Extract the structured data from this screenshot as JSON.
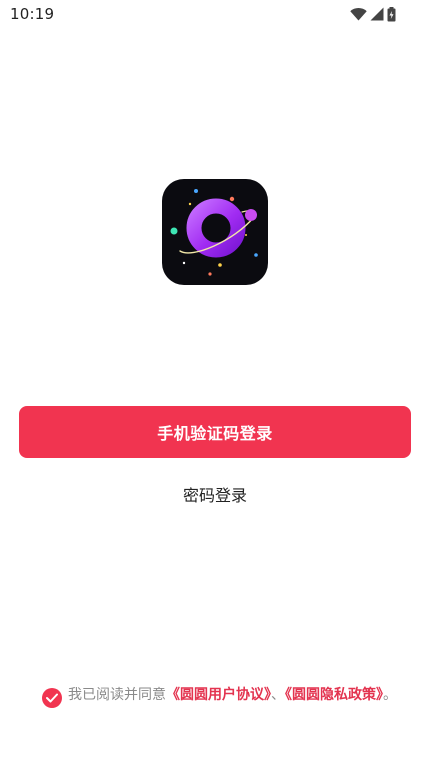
{
  "status_bar": {
    "time": "10:19",
    "icons": [
      "wifi-icon",
      "signal-icon",
      "battery-icon"
    ]
  },
  "logo": {
    "icon": "planet-ring-logo-icon"
  },
  "login": {
    "primary_label": "手机验证码登录",
    "secondary_label": "密码登录"
  },
  "agreement": {
    "checked": true,
    "prefix": "我已阅读并同意",
    "user_agreement": "《圆圆用户协议》",
    "separator": "、",
    "privacy_policy": "《圆圆隐私政策》",
    "suffix": "。"
  },
  "colors": {
    "accent": "#f13450",
    "link": "#e3334f",
    "muted_text": "#8a8a8a",
    "logo_bg": "#0b0b10"
  }
}
